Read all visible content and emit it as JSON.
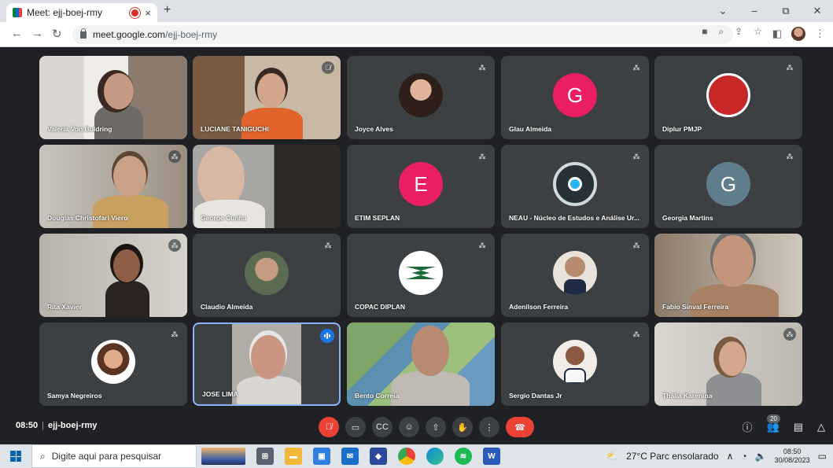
{
  "browser": {
    "tab_title": "Meet: ejj-boej-rmy",
    "tab_close": "×",
    "new_tab": "+",
    "url_host": "meet.google.com",
    "url_path": "/ejj-boej-rmy",
    "window_controls": {
      "tab_search": "⌄",
      "minimize": "–",
      "maximize": "⧉",
      "close": "✕"
    }
  },
  "participants": [
    {
      "name": "Valeria Von Buldring",
      "type": "video",
      "muted": false
    },
    {
      "name": "LUCIANE TANIGUCHI",
      "type": "video",
      "muted": true
    },
    {
      "name": "Joyce Alves",
      "type": "avatar-photo",
      "muted": true
    },
    {
      "name": "Glau Almeida",
      "type": "letter",
      "letter": "G",
      "color": "#e91e63",
      "muted": true
    },
    {
      "name": "Diplur PMJP",
      "type": "avatar-logo",
      "muted": true
    },
    {
      "name": "Douglas Christofari Viero",
      "type": "video",
      "muted": true
    },
    {
      "name": "George Cunha",
      "type": "video",
      "muted": false
    },
    {
      "name": "ETIM SEPLAN",
      "type": "letter",
      "letter": "E",
      "color": "#e91e63",
      "muted": true
    },
    {
      "name": "NEAU - Núcleo de Estudos e Análise Ur...",
      "type": "avatar-logo",
      "muted": true
    },
    {
      "name": "Georgia Martins",
      "type": "letter",
      "letter": "G",
      "color": "#607d8b",
      "muted": true
    },
    {
      "name": "Rita Xavier",
      "type": "video",
      "muted": true
    },
    {
      "name": "Claudio Almeida",
      "type": "avatar-photo",
      "muted": true
    },
    {
      "name": "COPAC DIPLAN",
      "type": "avatar-logo",
      "muted": true
    },
    {
      "name": "Adenilson Ferreira",
      "type": "avatar-photo",
      "muted": true
    },
    {
      "name": "Fabio Sinval Ferreira",
      "type": "video",
      "muted": false
    },
    {
      "name": "Samya Negreiros",
      "type": "avatar-photo",
      "muted": true
    },
    {
      "name": "JOSE LIMA",
      "type": "video",
      "muted": false,
      "speaking": true
    },
    {
      "name": "Bento Correia",
      "type": "video",
      "muted": false
    },
    {
      "name": "Sergio Dantas Jr",
      "type": "avatar-photo",
      "muted": true
    },
    {
      "name": "Thália Karenina",
      "type": "video",
      "muted": true
    }
  ],
  "meeting": {
    "time": "08:50",
    "code": "ejj-boej-rmy",
    "participant_count": "20"
  },
  "controls": {
    "mic": "mic-off-icon",
    "camera": "camera-icon",
    "captions": "captions-icon",
    "reactions": "emoji-icon",
    "present": "present-icon",
    "raise_hand": "hand-icon",
    "more": "more-vert-icon",
    "end_call": "end-call-icon"
  },
  "taskbar": {
    "search_placeholder": "Digite aqui para pesquisar",
    "weather": "27°C  Parc ensolarado",
    "time": "08:50",
    "date": "30/08/2023"
  }
}
